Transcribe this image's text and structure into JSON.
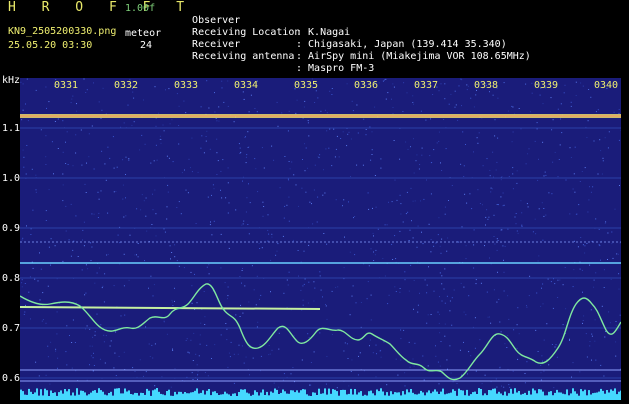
{
  "header": {
    "app_title": "H R O F F T",
    "version": "1.00f",
    "filename": "KN9_2505200330.png",
    "mode": "meteor",
    "timestamp": "25.05.20 03:30",
    "count": "24"
  },
  "meta": {
    "observer_label": "Observer",
    "observer_value": ": K.Nagai",
    "location_label": "Receiving Location",
    "location_value": ": Chigasaki, Japan (139.414 35.340)",
    "receiver_label": "Receiver",
    "receiver_value": ": AirSpy mini (Miakejima VOR 108.65MHz)",
    "antenna_label": "Receiving antenna",
    "antenna_value": ": Maspro FM-3"
  },
  "axis": {
    "y_unit": "kHz",
    "y_ticks": [
      "1.1",
      "1.0",
      "0.9",
      "0.8",
      "0.7",
      "0.6"
    ],
    "x_ticks": [
      "0331",
      "0332",
      "0333",
      "0334",
      "0335",
      "0336",
      "0337",
      "0338",
      "0339",
      "0340"
    ]
  },
  "colors": {
    "background": "#000000",
    "plot_bg": "#1a1c7a",
    "label_yellow": "#f0f070",
    "trace_green": "#7fe8a0",
    "carrier_line": "#e8d86a",
    "noise_floor": "#45d8ff"
  }
}
